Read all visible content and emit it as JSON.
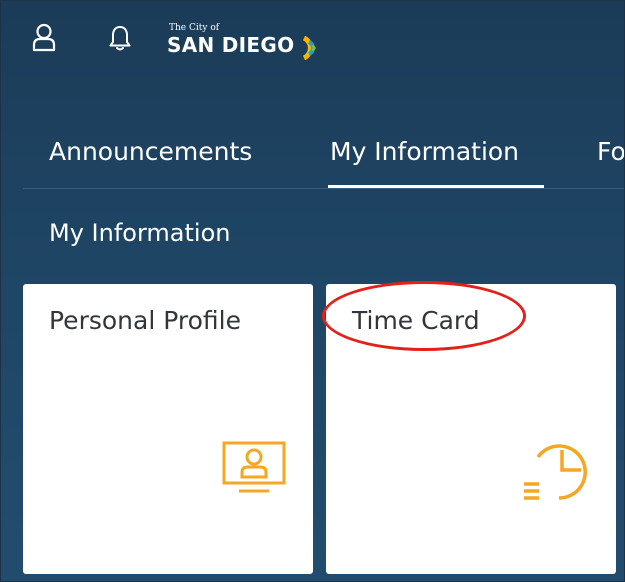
{
  "header": {
    "user_icon": "user-icon",
    "notification_icon": "bell-icon",
    "logo": {
      "small_text": "The City of",
      "main_text": "SAN DIEGO"
    }
  },
  "tabs": [
    {
      "label": "Announcements",
      "selected": false
    },
    {
      "label": "My Information",
      "selected": true
    },
    {
      "label": "Fo",
      "selected": false
    }
  ],
  "section": {
    "title": "My Information"
  },
  "tiles": [
    {
      "title": "Personal Profile",
      "icon": "profile-icon"
    },
    {
      "title": "Time Card",
      "icon": "clock-list-icon"
    }
  ],
  "colors": {
    "header_background": "#1f4565",
    "tile_icon": "#f5a623",
    "annotation_circle": "#e32119",
    "tile_text": "#32363a"
  }
}
